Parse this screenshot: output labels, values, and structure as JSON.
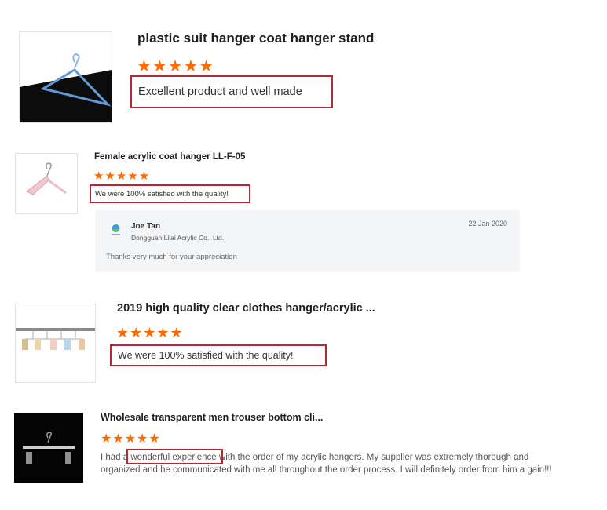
{
  "reviews": [
    {
      "title": "plastic suit hanger coat hanger stand",
      "stars": "★★★★★",
      "comment": "Excellent product and well made",
      "thumbnail_icon": "blue-hanger-image"
    },
    {
      "title": "Female acrylic coat hanger LL-F-05",
      "stars": "★★★★★",
      "comment": "We were 100% satisfied with the quality!",
      "thumbnail_icon": "pink-hanger-image",
      "reply": {
        "author": "Joe Tan",
        "company": "Dongguan Lilai Acrylic Co., Ltd.",
        "date": "22 Jan 2020",
        "message": "Thanks very much for your appreciation",
        "avatar_icon": "company-logo-icon"
      }
    },
    {
      "title": "2019 high quality clear clothes hanger/acrylic ...",
      "stars": "★★★★★",
      "comment": "We were 100% satisfied with the quality!",
      "thumbnail_icon": "clip-hangers-rack-image"
    },
    {
      "title": "Wholesale transparent men trouser bottom cli...",
      "stars": "★★★★★",
      "comment_before": "I had a ",
      "comment_highlight": "wonderful experience",
      "comment_after": " with the order of my acrylic hangers.  My supplier was extremely thorough and organized and he communicated with me all throughout the order process.  I will definitely order from him a gain!!!",
      "thumbnail_icon": "trouser-hanger-image"
    }
  ],
  "colors": {
    "star": "#ff6a00",
    "highlight_border": "#b8262f",
    "reply_bg": "#f4f5f7"
  }
}
